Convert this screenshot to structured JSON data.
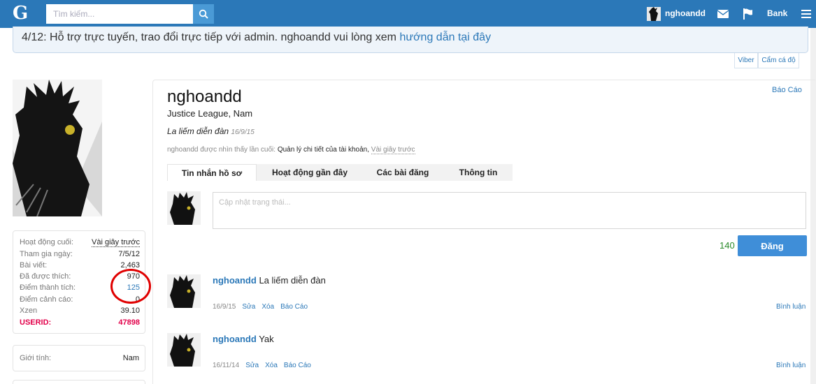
{
  "header": {
    "logo": "G",
    "search_placeholder": "Tìm kiếm...",
    "username": "nghoandd",
    "bank_label": "Bank"
  },
  "notice": {
    "text": "4/12: Hỗ trợ trực tuyến, trao đổi trực tiếp với admin. nghoandd vui lòng xem ",
    "link": "hướng dẫn tại đây"
  },
  "share_tabs": [
    "Viber",
    "Cẩm cá độ"
  ],
  "sidebar": {
    "stats": [
      {
        "label": "Hoạt động cuối:",
        "value": "Vài giây trước"
      },
      {
        "label": "Tham gia ngày:",
        "value": "7/5/12"
      },
      {
        "label": "Bài viết:",
        "value": "2,463"
      },
      {
        "label": "Đã được thích:",
        "value": "970"
      },
      {
        "label": "Điểm thành tích:",
        "value": "125"
      },
      {
        "label": "Điểm cảnh cáo:",
        "value": "0"
      },
      {
        "label": "Xzen",
        "value": "39.10"
      },
      {
        "label": "USERID:",
        "value": "47898"
      }
    ],
    "gender_label": "Giới tính:",
    "gender_value": "Nam"
  },
  "profile": {
    "report": "Báo Cáo",
    "username": "nghoandd",
    "title": "Justice League, Nam",
    "status": "La liếm diễn đàn",
    "status_date": "16/9/15",
    "last_seen_prefix": "nghoandd được nhìn thấy lần cuối:",
    "last_seen_action": "Quản lý chi tiết của tài khoản,",
    "last_seen_time": "Vài giây trước",
    "tabs": [
      "Tin nhắn hồ sơ",
      "Hoạt động gần đây",
      "Các bài đăng",
      "Thông tin"
    ],
    "status_placeholder": "Cập nhật trạng thái...",
    "char_count": "140",
    "post_button": "Đăng"
  },
  "messages": [
    {
      "user": "nghoandd",
      "text": "La liếm diễn đàn",
      "date": "16/9/15",
      "actions": [
        "Sửa",
        "Xóa",
        "Báo Cáo"
      ],
      "comment": "Bình luận"
    },
    {
      "user": "nghoandd",
      "text": "Yak",
      "date": "16/11/14",
      "actions": [
        "Sửa",
        "Xóa",
        "Báo Cáo"
      ],
      "comment": "Bình luận"
    }
  ],
  "colors": {
    "header_bg": "#2b78b8",
    "link": "#2b78b8",
    "userid": "#e2004a",
    "circle": "#e00000"
  }
}
